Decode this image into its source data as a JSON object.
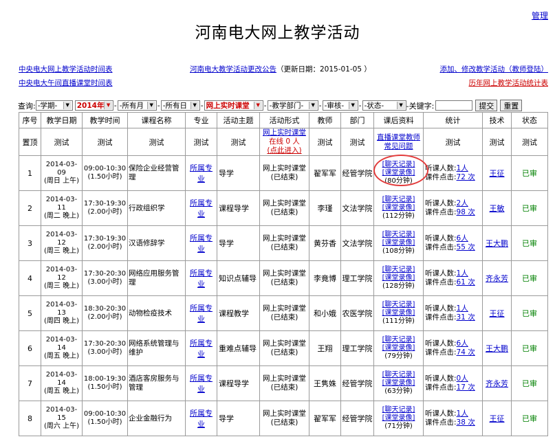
{
  "header": {
    "admin_label": "管理",
    "title": "河南电大网上教学活动"
  },
  "toplinks": {
    "left1": "中央电大网上教学活动时间表",
    "left2": "中央电大午间直播课堂时间表",
    "center": "河南电大教学活动更改公告",
    "update": "（更新日期：2015-01-05 ）",
    "right1": "添加、修改教学活动（教师登陆）",
    "right2": "历年网上教学活动统计表"
  },
  "filters": {
    "query_label": "查询:",
    "semester": "-学期-",
    "year": "2014年",
    "month": "-所有月",
    "day": "-所有日",
    "form": "网上实时课堂",
    "dept": "-教学部门-",
    "review": "-审核-",
    "status": "-状态-",
    "keyword_label": "-关键字:",
    "submit_label": "提交",
    "reset_label": "重置"
  },
  "columns": [
    "序号",
    "教学日期",
    "教学时间",
    "课程名称",
    "专业",
    "活动主题",
    "活动形式",
    "教师",
    "部门",
    "课后资料",
    "统计",
    "技术",
    "状态"
  ],
  "pinned": {
    "label": "置顶",
    "cell": "测试",
    "form_link1": "网上实时课堂",
    "form_online": "在线 0 人",
    "form_link2": "(点此进入)",
    "materials_link1": "直播课堂教师",
    "materials_link2": "常见问题"
  },
  "rows": [
    {
      "no": "1",
      "date": "2014-03-09",
      "week": "(周日 上午)",
      "time": "09:00-10:30",
      "hours": "(1.50小时)",
      "course": "保险企业经营管理",
      "major": "所属专业",
      "topic": "导学",
      "form1": "网上实时课堂",
      "form2": "(已结束)",
      "teacher": "翟军军",
      "dept": "经管学院",
      "mat1": "[聊天记录]",
      "mat2": "[课堂录像]",
      "mat3": "(80分钟)",
      "stat1_label": "听课人数:",
      "stat1_val": "1人",
      "stat2_label": "课件点击:",
      "stat2_val": "72 次",
      "tech": "王征",
      "status": "已审"
    },
    {
      "no": "2",
      "date": "2014-03-11",
      "week": "(周二 晚上)",
      "time": "17:30-19:30",
      "hours": "(2.00小时)",
      "course": "行政组织学",
      "major": "所属专业",
      "topic": "课程导学",
      "form1": "网上实时课堂",
      "form2": "(已结束)",
      "teacher": "李瑾",
      "dept": "文法学院",
      "mat1": "[聊天记录]",
      "mat2": "[课堂录像]",
      "mat3": "(112分钟)",
      "stat1_label": "听课人数:",
      "stat1_val": "2人",
      "stat2_label": "课件点击:",
      "stat2_val": "98 次",
      "tech": "王敏",
      "status": "已审"
    },
    {
      "no": "3",
      "date": "2014-03-12",
      "week": "(周三 晚上)",
      "time": "17:30-19:30",
      "hours": "(2.00小时)",
      "course": "汉语修辞学",
      "major": "所属专业",
      "topic": "导学",
      "form1": "网上实时课堂",
      "form2": "(已结束)",
      "teacher": "黄芬香",
      "dept": "文法学院",
      "mat1": "[聊天记录]",
      "mat2": "[课堂录像]",
      "mat3": "(108分钟)",
      "stat1_label": "听课人数:",
      "stat1_val": "6人",
      "stat2_label": "课件点击:",
      "stat2_val": "55 次",
      "tech": "王大鹏",
      "status": "已审"
    },
    {
      "no": "4",
      "date": "2014-03-12",
      "week": "(周三 晚上)",
      "time": "17:30-20:30",
      "hours": "(3.00小时)",
      "course": "网络应用服务管理",
      "major": "所属专业",
      "topic": "知识点辅导",
      "form1": "网上实时课堂",
      "form2": "(已结束)",
      "teacher": "李竟博",
      "dept": "理工学院",
      "mat1": "[聊天记录]",
      "mat2": "[课堂录像]",
      "mat3": "(128分钟)",
      "stat1_label": "听课人数:",
      "stat1_val": "1人",
      "stat2_label": "课件点击:",
      "stat2_val": "61 次",
      "tech": "齐永芳",
      "status": "已审"
    },
    {
      "no": "5",
      "date": "2014-03-13",
      "week": "(周四 晚上)",
      "time": "18:30-20:30",
      "hours": "(2.00小时)",
      "course": "动物检疫技术",
      "major": "所属专业",
      "topic": "课程教学",
      "form1": "网上实时课堂",
      "form2": "(已结束)",
      "teacher": "和小娥",
      "dept": "农医学院",
      "mat1": "[聊天记录]",
      "mat2": "[课堂录像]",
      "mat3": "(111分钟)",
      "stat1_label": "听课人数:",
      "stat1_val": "1人",
      "stat2_label": "课件点击:",
      "stat2_val": "31 次",
      "tech": "王征",
      "status": "已审"
    },
    {
      "no": "6",
      "date": "2014-03-14",
      "week": "(周五 晚上)",
      "time": "17:30-20:30",
      "hours": "(3.00小时)",
      "course": "网络系统管理与维护",
      "major": "所属专业",
      "topic": "重难点辅导",
      "form1": "网上实时课堂",
      "form2": "(已结束)",
      "teacher": "王翔",
      "dept": "理工学院",
      "mat1": "[聊天记录]",
      "mat2": "[课堂录像]",
      "mat3": "(79分钟)",
      "stat1_label": "听课人数:",
      "stat1_val": "6人",
      "stat2_label": "课件点击:",
      "stat2_val": "74 次",
      "tech": "王大鹏",
      "status": "已审"
    },
    {
      "no": "7",
      "date": "2014-03-14",
      "week": "(周五 晚上)",
      "time": "18:00-19:30",
      "hours": "(1.50小时)",
      "course": "酒店客房服务与管理",
      "major": "所属专业",
      "topic": "课程导学",
      "form1": "网上实时课堂",
      "form2": "(已结束)",
      "teacher": "王隽姝",
      "dept": "经管学院",
      "mat1": "[聊天记录]",
      "mat2": "[课堂录像]",
      "mat3": "(63分钟)",
      "stat1_label": "听课人数:",
      "stat1_val": "0人",
      "stat2_label": "课件点击:",
      "stat2_val": "17 次",
      "tech": "齐永芳",
      "status": "已审"
    },
    {
      "no": "8",
      "date": "2014-03-15",
      "week": "(周六 上午)",
      "time": "09:00-10:30",
      "hours": "(1.50小时)",
      "course": "企业金融行为",
      "major": "所属专业",
      "topic": "导学",
      "form1": "网上实时课堂",
      "form2": "(已结束)",
      "teacher": "翟军军",
      "dept": "经管学院",
      "mat1": "[聊天记录]",
      "mat2": "[课堂录像]",
      "mat3": "(71分钟)",
      "stat1_label": "听课人数:",
      "stat1_val": "1人",
      "stat2_label": "课件点击:",
      "stat2_val": "38 次",
      "tech": "王征",
      "status": "已审"
    }
  ],
  "colors": {
    "link": "#0000cc",
    "red": "#cc0000",
    "passed": "#008000",
    "circle": "#e23b3b"
  }
}
